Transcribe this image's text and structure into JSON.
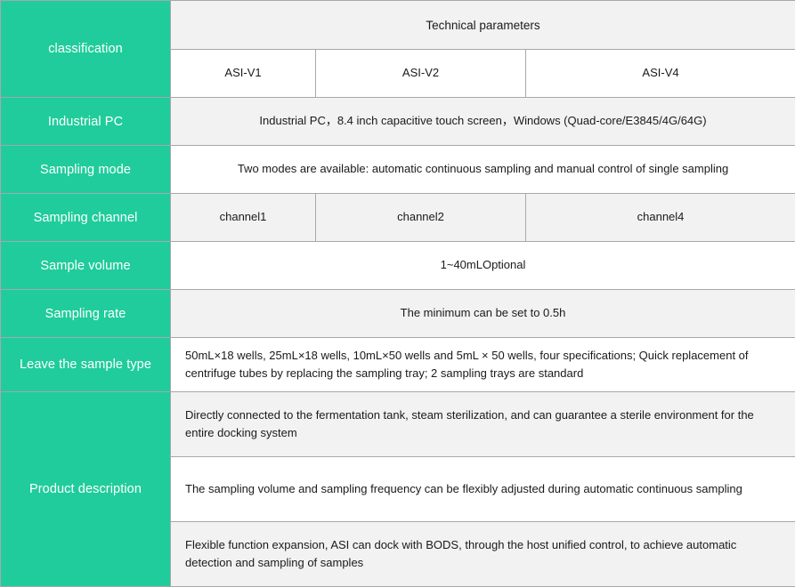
{
  "table": {
    "colors": {
      "label_background": "#20cc9c",
      "label_text": "#ffffff",
      "row_gray": "#f2f2f2",
      "row_white": "#ffffff",
      "border": "#a8a8a8"
    },
    "label_column_header": "classification",
    "parameters_header": "Technical parameters",
    "models": [
      "ASI-V1",
      "ASI-V2",
      "ASI-V4"
    ],
    "rows": [
      {
        "label": "Industrial PC",
        "value": "Industrial PC，8.4 inch capacitive touch screen，Windows (Quad-core/E3845/4G/64G)"
      },
      {
        "label": "Sampling mode",
        "value": "Two modes are available: automatic continuous sampling and manual control of single sampling"
      },
      {
        "label": "Sampling channel",
        "channels": [
          "channel1",
          "channel2",
          "channel4"
        ]
      },
      {
        "label": "Sample volume",
        "value": "1~40mLOptional"
      },
      {
        "label": "Sampling rate",
        "value": "The minimum can be set to 0.5h"
      },
      {
        "label": "Leave the sample type",
        "value": "50mL×18 wells, 25mL×18 wells, 10mL×50 wells and 5mL × 50 wells, four specifications; Quick replacement of centrifuge tubes by replacing the sampling tray; 2 sampling trays are standard"
      }
    ],
    "product_description": {
      "label": "Product description",
      "items": [
        "Directly connected to the fermentation tank, steam sterilization, and can guarantee a sterile environment for the entire docking system",
        "The sampling volume and sampling frequency can be flexibly adjusted during automatic continuous sampling",
        "Flexible function expansion, ASI can dock with BODS, through the host unified control, to achieve automatic detection and sampling of samples"
      ]
    }
  }
}
